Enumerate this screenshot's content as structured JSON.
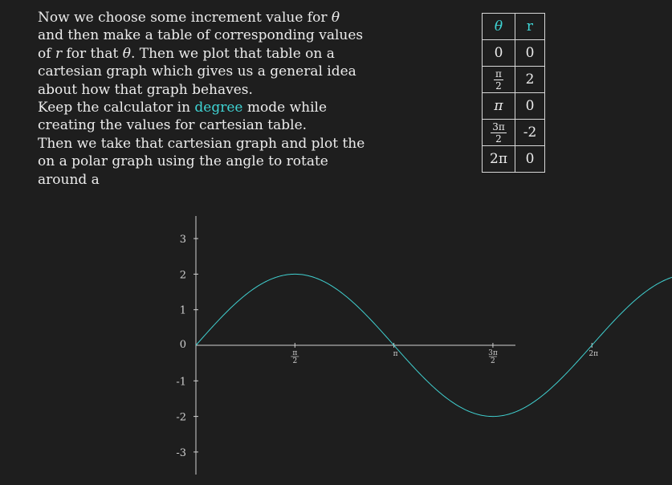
{
  "intro": {
    "line1_a": "Now we choose some increment value for ",
    "theta": "θ",
    "line1_b": " and then make a table of corresponding values of ",
    "r": "r",
    "line1_c": " for that ",
    "line1_d": ". Then we plot that table on a cartesian graph which gives us a general idea about how that graph behaves.",
    "line2_a": "Keep the calculator in ",
    "degree": "degree",
    "line2_b": " mode while creating the values for cartesian table.",
    "line3": "Then we take that cartesian graph and plot the on a polar graph using the angle to rotate around a"
  },
  "table": {
    "headers": [
      "θ",
      "r"
    ],
    "rows": [
      {
        "theta_plain": "0",
        "r": "0"
      },
      {
        "theta_num": "π",
        "theta_den": "2",
        "r": "2"
      },
      {
        "theta_plain": "π",
        "r": "0"
      },
      {
        "theta_num": "3π",
        "theta_den": "2",
        "r": "-2"
      },
      {
        "theta_plain": "2π",
        "r": "0"
      }
    ]
  },
  "chart_data": {
    "type": "line",
    "function": "r = 2 sin(θ)",
    "y_ticks": [
      "3",
      "2",
      "1",
      "0",
      "-1",
      "-2",
      "-3"
    ],
    "x_ticks": [
      {
        "num": "π",
        "den": "2"
      },
      {
        "label": "π"
      },
      {
        "num": "3π",
        "den": "2"
      },
      {
        "label": "2π"
      }
    ],
    "x_range_radians": [
      0,
      9.6
    ],
    "y_range": [
      -3.5,
      3.5
    ],
    "series": [
      {
        "x": [
          0,
          0.785,
          1.571,
          2.356,
          3.142,
          3.927,
          4.712,
          5.498,
          6.283,
          7.069,
          7.854,
          8.639,
          9.425
        ],
        "y": [
          0,
          1.414,
          2,
          1.414,
          0,
          -1.414,
          -2,
          -1.414,
          0,
          1.414,
          2,
          1.414,
          0
        ]
      }
    ],
    "colors": {
      "curve": "#40d0d0",
      "axes": "#d0d0d0"
    }
  }
}
